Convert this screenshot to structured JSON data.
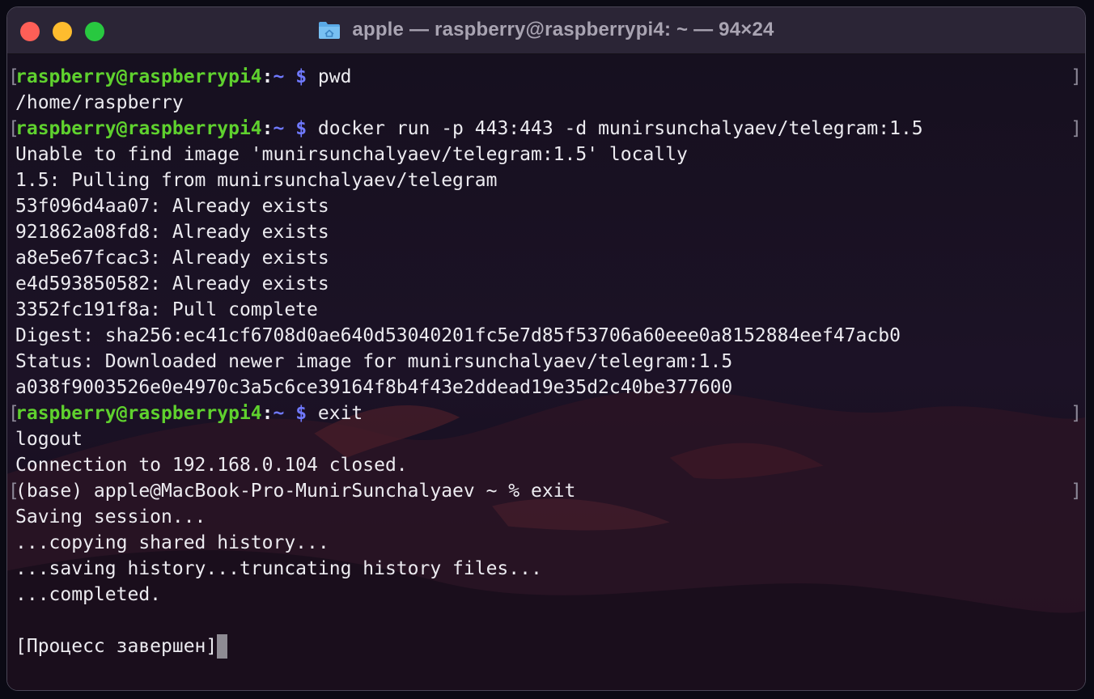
{
  "window": {
    "title": "apple — raspberry@raspberrypi4: ~ — 94×24",
    "traffic_lights": [
      "close",
      "minimize",
      "zoom"
    ],
    "colors": {
      "close": "#fe5f57",
      "minimize": "#febc2e",
      "zoom": "#28c840",
      "prompt_user": "#5fd12e",
      "prompt_dir": "#6f79ff",
      "text": "#ecebf0"
    }
  },
  "prompt": {
    "user_host": "raspberry@raspberrypi4",
    "sep": ":",
    "dir_symbol": "~ $"
  },
  "lines": [
    {
      "type": "prompt",
      "cmd": " pwd"
    },
    {
      "type": "out",
      "text": "/home/raspberry"
    },
    {
      "type": "prompt",
      "cmd": " docker run -p 443:443 -d munirsunchalyaev/telegram:1.5"
    },
    {
      "type": "out",
      "text": "Unable to find image 'munirsunchalyaev/telegram:1.5' locally"
    },
    {
      "type": "out",
      "text": "1.5: Pulling from munirsunchalyaev/telegram"
    },
    {
      "type": "out",
      "text": "53f096d4aa07: Already exists"
    },
    {
      "type": "out",
      "text": "921862a08fd8: Already exists"
    },
    {
      "type": "out",
      "text": "a8e5e67fcac3: Already exists"
    },
    {
      "type": "out",
      "text": "e4d593850582: Already exists"
    },
    {
      "type": "out",
      "text": "3352fc191f8a: Pull complete"
    },
    {
      "type": "out",
      "text": "Digest: sha256:ec41cf6708d0ae640d53040201fc5e7d85f53706a60eee0a8152884eef47acb0"
    },
    {
      "type": "out",
      "text": "Status: Downloaded newer image for munirsunchalyaev/telegram:1.5"
    },
    {
      "type": "out",
      "text": "a038f9003526e0e4970c3a5c6ce39164f8b4f43e2ddead19e35d2c40be377600"
    },
    {
      "type": "prompt",
      "cmd": " exit"
    },
    {
      "type": "out",
      "text": "logout"
    },
    {
      "type": "out",
      "text": "Connection to 192.168.0.104 closed."
    },
    {
      "type": "out-marked",
      "text": "(base) apple@MacBook-Pro-MunirSunchalyaev ~ % exit"
    },
    {
      "type": "out",
      "text": "Saving session..."
    },
    {
      "type": "out",
      "text": "...copying shared history..."
    },
    {
      "type": "out",
      "text": "...saving history...truncating history files..."
    },
    {
      "type": "out",
      "text": "...completed."
    },
    {
      "type": "out",
      "text": ""
    },
    {
      "type": "final",
      "text": "[Процесс завершен]"
    }
  ]
}
